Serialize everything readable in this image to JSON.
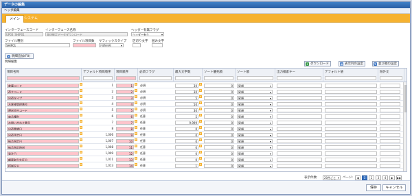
{
  "window": {
    "title": "データの編集"
  },
  "subheader": {
    "title": "ヘッダ編集"
  },
  "tabs": [
    {
      "label": "メイン"
    },
    {
      "label": "システム"
    }
  ],
  "form": {
    "interface_code_label": "インターフェースコード",
    "interface_code_value": "UP03_SHIP01",
    "interface_name_label": "インターフェース名称",
    "interface_name_value": "発送確定データダウンロード",
    "header_flag_label": "ヘッダー有無フラグ",
    "header_flag_value": "ヘッダー有り",
    "file_type_label": "ファイル種別",
    "file_type_value": "SHIP01",
    "file_items_label": "ファイル項目数",
    "file_items_value": "",
    "suffix_label": "サフィックスタイプ",
    "suffix_value": "日時分秒",
    "delimiter_label": "区切り文字",
    "enclosure_label": "囲み文字"
  },
  "add_button": "明細追加(F8)",
  "section_title": "明細編集",
  "toolbar": {
    "download": "ダウンロード",
    "view_settings": "表示列の設定",
    "sort_settings": "並び順の設定"
  },
  "columns": [
    "項目名称",
    "デフォルト項目順序",
    "項目順序",
    "必須フラグ",
    "最大文字数",
    "ソート優先順",
    "ソート順",
    "出力検索キー",
    "デフォルト値",
    "除外文"
  ],
  "rows": [
    {
      "name": "倉庫コード",
      "default_order": "1",
      "order": "1",
      "required": "必須",
      "max": "30",
      "sort_pri": "0",
      "sort": "昇順"
    },
    {
      "name": "荷主コード",
      "default_order": "2",
      "order": "2",
      "required": "必須",
      "max": "30",
      "sort_pri": "0",
      "sort": "昇順"
    },
    {
      "name": "出荷タイプ",
      "default_order": "3",
      "order": "3",
      "required": "必須",
      "max": "5",
      "sort_pri": "0",
      "sort": "昇順"
    },
    {
      "name": "お客様管理番号",
      "default_order": "4",
      "order": "4",
      "required": "必須",
      "max": "50",
      "sort_pri": "0",
      "sort": "昇順"
    },
    {
      "name": "運送会社コード",
      "default_order": "5",
      "order": "5",
      "required": "必須",
      "max": "30",
      "sort_pri": "0",
      "sort": "昇順"
    },
    {
      "name": "商品種別",
      "default_order": "6",
      "order": "6",
      "required": "任意",
      "max": "5",
      "sort_pri": "0",
      "sort": "昇順"
    },
    {
      "name": "お問い合わせ番号",
      "default_order": "7",
      "order": "7",
      "required": "任意",
      "max": "9,999",
      "sort_pri": "0",
      "sort": "昇順"
    },
    {
      "name": "出荷実績日",
      "default_order": "8",
      "order": "8",
      "required": "任意",
      "max": "0",
      "sort_pri": "0",
      "sort": "昇順"
    },
    {
      "name": "出荷予定日",
      "default_order": "1,006",
      "order": "9",
      "required": "任意",
      "max": "0",
      "sort_pri": "0",
      "sort": "昇順"
    },
    {
      "name": "納品指定日",
      "default_order": "1,007",
      "order": "10",
      "required": "任意",
      "max": "0",
      "sort_pri": "0",
      "sort": "昇順"
    },
    {
      "name": "納品指定時刻",
      "default_order": "1,008",
      "order": "11",
      "required": "任意",
      "max": "0",
      "sort_pri": "0",
      "sort": "昇順"
    },
    {
      "name": "発注日",
      "default_order": "1,009",
      "order": "12",
      "required": "任意",
      "max": "0",
      "sort_pri": "0",
      "sort": "昇順"
    },
    {
      "name": "顧客取引先区分",
      "default_order": "1,011",
      "order": "13",
      "required": "任意",
      "max": "0",
      "sort_pri": "0",
      "sort": "昇順"
    },
    {
      "name": "PDK区分",
      "default_order": "1,013",
      "order": "14",
      "required": "任意",
      "max": "1",
      "sort_pri": "0",
      "sort": "昇順"
    }
  ],
  "pager": {
    "count_label": "表示件数:",
    "count_value": "20件ごと",
    "page_label": "ページ:",
    "pages": [
      "1",
      "2",
      "3",
      "4"
    ]
  },
  "footer": {
    "save": "保存",
    "cancel": "キャンセル"
  },
  "colors": {
    "accent": "#f6b230",
    "required_field": "#ffc4cb",
    "title_bar": "#3f7fc7"
  }
}
